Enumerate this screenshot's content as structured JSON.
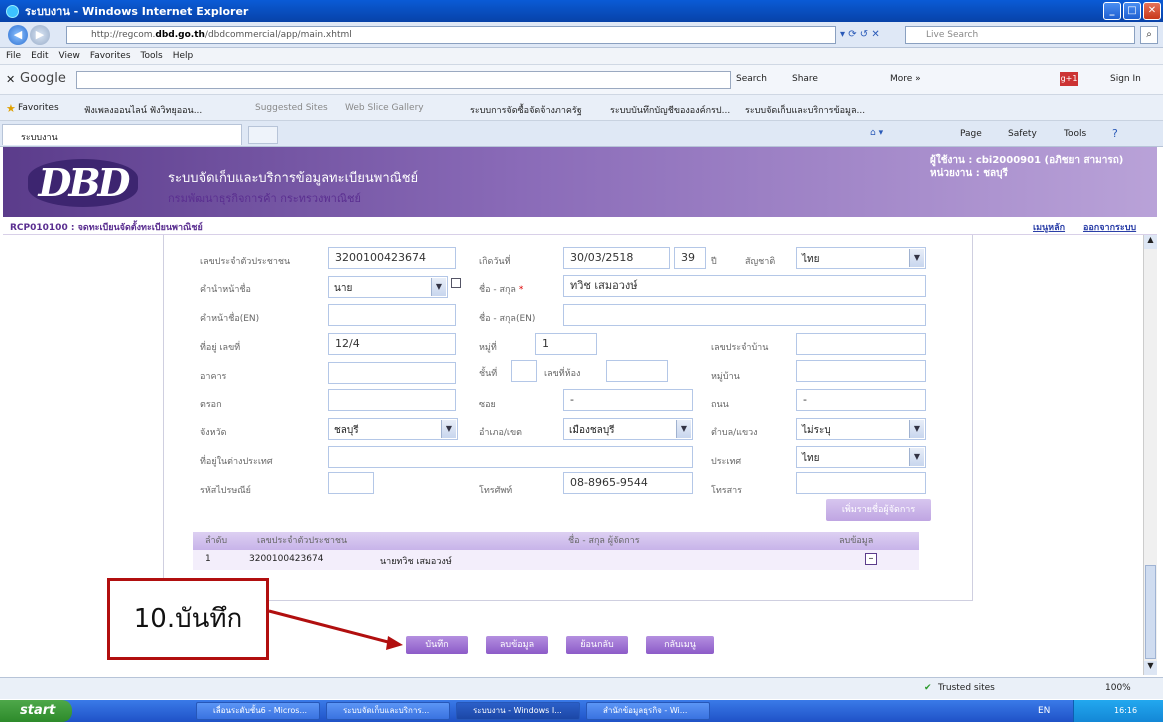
{
  "window": {
    "title": "ระบบงาน - Windows Internet Explorer"
  },
  "address": {
    "url_prefix": "http://regcom.",
    "url_domain": "dbd.go.th",
    "url_path": "/dbdcommercial/app/main.xhtml",
    "search_placeholder": "Live Search"
  },
  "menu": [
    "File",
    "Edit",
    "View",
    "Favorites",
    "Tools",
    "Help"
  ],
  "google": {
    "label": "Google",
    "search_label": "Search",
    "share_label": "Share",
    "more_label": "More »",
    "signin_label": "Sign In"
  },
  "favorites": {
    "label": "Favorites",
    "items": [
      "ฟังเพลงออนไลน์ ฟังวิทยุออน...",
      "Suggested Sites",
      "Web Slice Gallery",
      "ระบบการจัดซื้อจัดจ้างภาครัฐ",
      "ระบบบันทึกบัญชีขององค์กรป...",
      "ระบบจัดเก็บและบริการข้อมูล..."
    ]
  },
  "tab": {
    "label": "ระบบงาน",
    "tools": [
      "Page",
      "Safety",
      "Tools"
    ]
  },
  "header": {
    "logo": "DBD",
    "title": "ระบบจัดเก็บและบริการข้อมูลทะเบียนพาณิชย์",
    "subtitle": "กรมพัฒนาธุรกิจการค้า กระทรวงพาณิชย์",
    "user": "ผู้ใช้งาน : cbi2000901 (อภิชยา สามารถ)",
    "unit": "หน่วยงาน : ชลบุรี"
  },
  "breadcrumb": {
    "code": "RCP010100 : จดทะเบียนจัดตั้งทะเบียนพาณิชย์",
    "main_menu": "เมนูหลัก",
    "logout": "ออกจากระบบ"
  },
  "form": {
    "id_label": "เลขประจำตัวประชาชน",
    "id_value": "3200100423674",
    "dob_label": "เกิดวันที่",
    "dob_value": "30/03/2518",
    "age_value": "39",
    "age_unit": "ปี",
    "nationality_label": "สัญชาติ",
    "nationality_value": "ไทย",
    "prefix_label": "คำนำหน้าชื่อ",
    "prefix_value": "นาย",
    "name_label": "ชื่อ - สกุล",
    "name_required": "*",
    "name_value": "ทวิช เสมอวงษ์",
    "prefix_en_label": "คำหน้าชื่อ(EN)",
    "name_en_label": "ชื่อ - สกุล(EN)",
    "address_no_label": "ที่อยู่ เลขที่",
    "address_no_value": "12/4",
    "moo_label": "หมู่ที่",
    "moo_value": "1",
    "house_id_label": "เลขประจำบ้าน",
    "building_label": "อาคาร",
    "floor_label": "ชั้นที่",
    "room_label": "เลขที่ห้อง",
    "village_label": "หมู่บ้าน",
    "trok_label": "ตรอก",
    "soi_label": "ซอย",
    "soi_value": "-",
    "road_label": "ถนน",
    "road_value": "-",
    "province_label": "จังหวัด",
    "province_value": "ชลบุรี",
    "district_label": "อำเภอ/เขต",
    "district_value": "เมืองชลบุรี",
    "subdistrict_label": "ตำบล/แขวง",
    "subdistrict_value": "ไม่ระบุ",
    "abroad_label": "ที่อยู่ในต่างประเทศ",
    "country_label": "ประเทศ",
    "country_value": "ไทย",
    "postcode_label": "รหัสไปรษณีย์",
    "phone_label": "โทรศัพท์",
    "phone_value": "08-8965-9544",
    "fax_label": "โทรสาร",
    "add_manager_button": "เพิ่มรายชื่อผู้จัดการ"
  },
  "table": {
    "headers": [
      "ลำดับ",
      "เลขประจำตัวประชาชน",
      "ชื่อ - สกุล ผู้จัดการ",
      "ลบข้อมูล"
    ],
    "rows": [
      {
        "no": "1",
        "id": "3200100423674",
        "name": "นายทวิช เสมอวงษ์"
      }
    ]
  },
  "actions": {
    "save": "บันทึก",
    "delete": "ลบข้อมูล",
    "back": "ย้อนกลับ",
    "menu": "กลับเมนู"
  },
  "callout": "10.บันทึก",
  "status": {
    "zone": "Trusted sites",
    "zoom": "100%"
  },
  "taskbar": {
    "start": "start",
    "tasks": [
      "เลื่อนระดับชั้น6 - Micros...",
      "ระบบจัดเก็บและบริการ...",
      "ระบบงาน - Windows I...",
      "สำนักข้อมูลธุรกิจ - Wi..."
    ],
    "lang": "EN",
    "clock": "16:16"
  }
}
